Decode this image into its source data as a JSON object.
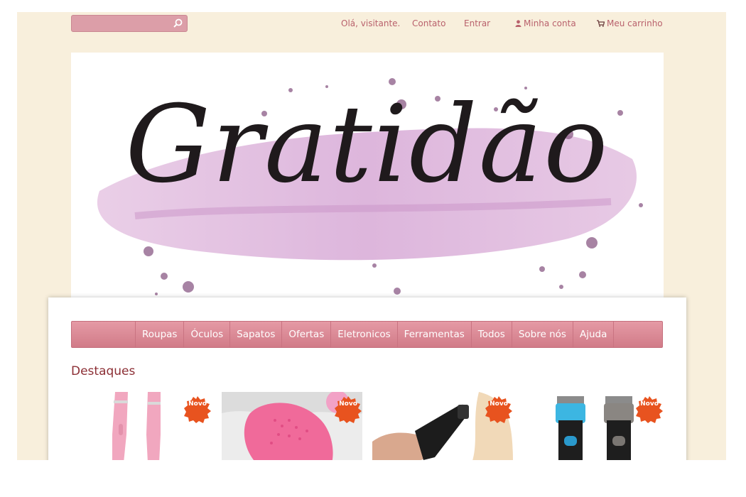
{
  "search": {
    "placeholder": ""
  },
  "header": {
    "greeting": "Olá, visitante.",
    "contact": "Contato",
    "login": "Entrar",
    "account": "Minha conta",
    "cart": "Meu carrinho"
  },
  "banner": {
    "title": "Gratidão"
  },
  "nav": {
    "items": [
      "Roupas",
      "Óculos",
      "Sapatos",
      "Ofertas",
      "Eletronicos",
      "Ferramentas",
      "Todos",
      "Sobre nós",
      "Ajuda"
    ]
  },
  "featured": {
    "title": "Destaques",
    "products": [
      {
        "badge": "Novo"
      },
      {
        "badge": "Novo"
      },
      {
        "badge": "Novo"
      },
      {
        "badge": "Novo"
      }
    ]
  },
  "colors": {
    "page_bg": "#f8efdc",
    "accent": "#d9848f",
    "heading": "#8c2f35",
    "badge": "#e8531f"
  }
}
